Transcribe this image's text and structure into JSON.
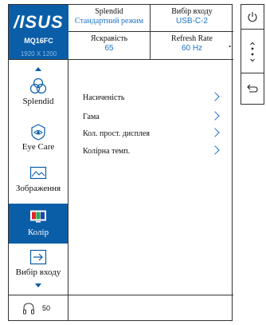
{
  "header": {
    "brand": "/ISUS",
    "model": "MQ16FC",
    "resolution": "1920 X 1200",
    "splendid_label": "Splendid",
    "splendid_value": "Стандартний режим",
    "input_label": "Вибір входу",
    "input_value": "USB-C-2",
    "brightness_label": "Яскравість",
    "brightness_value": "65",
    "refresh_label": "Refresh Rate",
    "refresh_value": "60 Hz"
  },
  "sidebar": {
    "items": [
      {
        "label": "Splendid",
        "icon": "splendid-icon"
      },
      {
        "label": "Eye Care",
        "icon": "eye-care-icon"
      },
      {
        "label": "Зображення",
        "icon": "image-icon"
      },
      {
        "label": "Колір",
        "icon": "color-icon"
      },
      {
        "label": "Вибір входу",
        "icon": "input-select-icon"
      }
    ],
    "active_index": 3
  },
  "menu": {
    "options": [
      {
        "label": "Насиченість"
      },
      {
        "label": "Гама"
      },
      {
        "label": "Кол. прост. дисплея"
      },
      {
        "label": "Колірна темп."
      }
    ]
  },
  "footer": {
    "volume": "50"
  },
  "colors": {
    "brand_blue": "#0a5ea8",
    "value_blue": "#1a73c8"
  }
}
